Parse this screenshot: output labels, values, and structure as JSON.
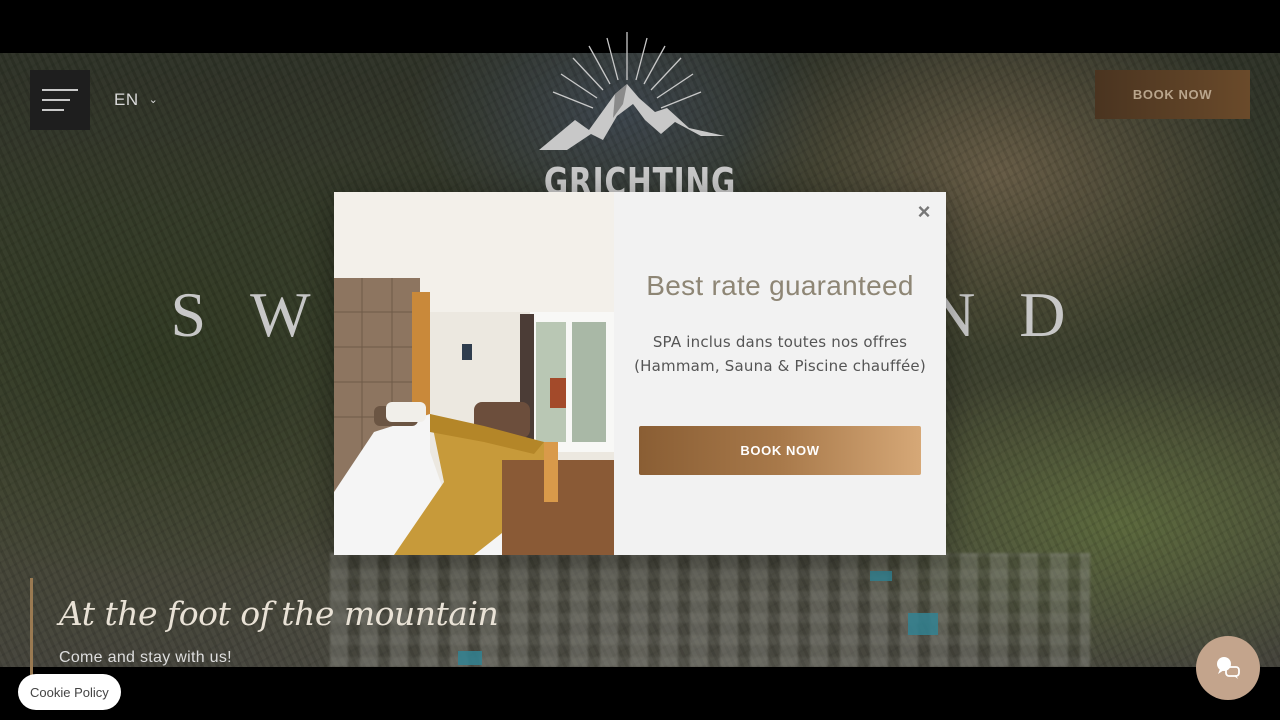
{
  "header": {
    "language": "EN",
    "logo_text": "GRICHTING HOTEL",
    "book_now_label": "BOOK NOW"
  },
  "hero": {
    "headline": "SWITZERLAND",
    "tagline_script": "At the foot of the mountain",
    "tagline_sub": "Come and stay with us!"
  },
  "modal": {
    "title": "Best rate guaranteed",
    "text": "SPA inclus dans toutes nos offres (Hammam, Sauna & Piscine chauffée)",
    "button_label": "BOOK NOW",
    "close_glyph": "×",
    "image": "hotel-room-photo"
  },
  "cookie": {
    "label": "Cookie Policy"
  },
  "icons": {
    "menu": "hamburger-icon",
    "language_dropdown": "chevron-down-icon",
    "logo": "mountain-logo-icon",
    "close": "close-icon",
    "chat": "chat-icon"
  },
  "colors": {
    "accent_brown": "#8a5e34",
    "accent_tan": "#d6a877",
    "modal_bg": "#f2f2f2",
    "title_color": "#8e8675",
    "chat_bg": "#c3a48c"
  }
}
